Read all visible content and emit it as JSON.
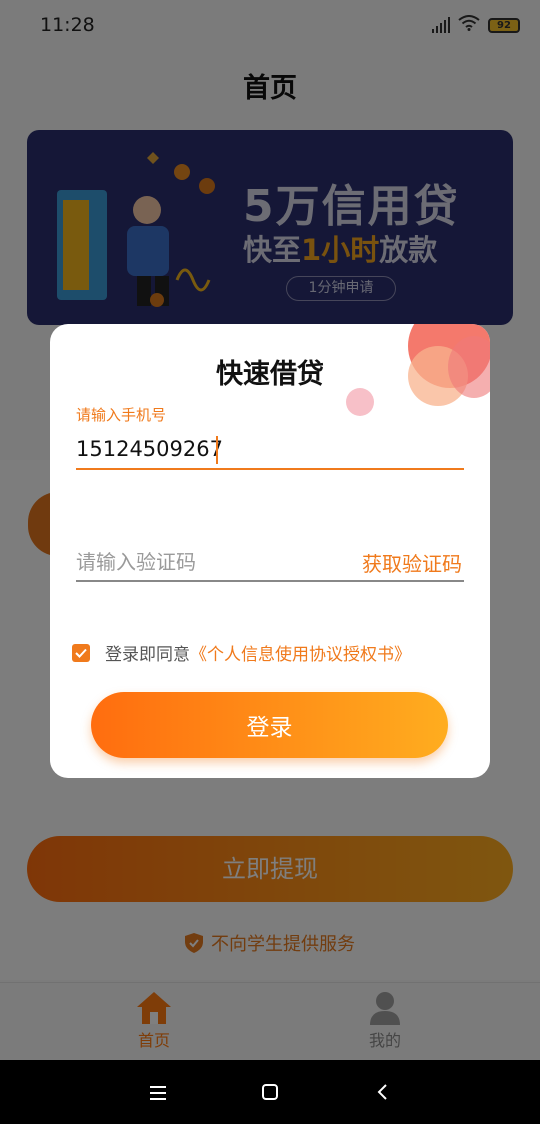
{
  "status_bar": {
    "time": "11:28",
    "battery": "92"
  },
  "header": {
    "title": "首页"
  },
  "banner": {
    "line1": "5万信用贷",
    "line2_pre": "快至",
    "line2_highlight": "1小时",
    "line2_post": "放款",
    "pill": "1分钟申请"
  },
  "main": {
    "withdraw_label": "立即提现",
    "notice": "不向学生提供服务"
  },
  "tabbar": {
    "tabs": [
      {
        "label": "首页",
        "active": true
      },
      {
        "label": "我的",
        "active": false
      }
    ]
  },
  "modal": {
    "title": "快速借贷",
    "phone_label": "请输入手机号",
    "phone_value": "15124509267",
    "code_placeholder": "请输入验证码",
    "get_code_label": "获取验证码",
    "agree_text": "登录即同意",
    "agree_link": "《个人信息使用协议授权书》",
    "agree_checked": true,
    "login_label": "登录"
  },
  "colors": {
    "accent": "#f07a1c",
    "gradient_start": "#ff6d0f",
    "gradient_end": "#ffad1f",
    "banner_bg": "#2b2f6e"
  }
}
